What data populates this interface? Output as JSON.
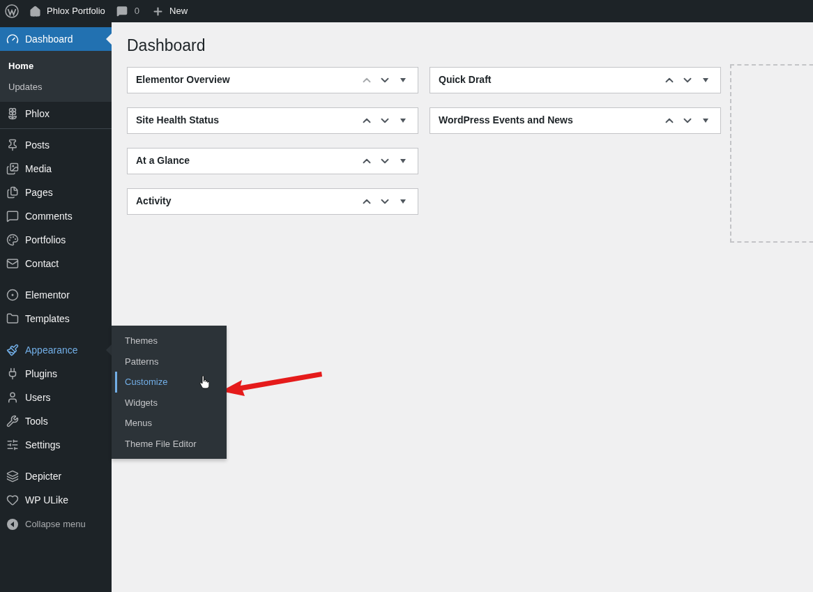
{
  "admin_bar": {
    "site_name": "Phlox Portfolio",
    "comments_count": "0",
    "new_label": "New"
  },
  "sidebar": {
    "groups": [
      [
        {
          "label": "Dashboard",
          "selected": true,
          "submenu": [
            {
              "label": "Home",
              "selected": true
            },
            {
              "label": "Updates",
              "selected": false
            }
          ]
        }
      ],
      [
        {
          "label": "Phlox",
          "selected": false,
          "highlighted": false
        }
      ],
      [
        {
          "label": "Posts",
          "selected": false,
          "highlighted": false
        },
        {
          "label": "Media",
          "selected": false,
          "highlighted": false
        },
        {
          "label": "Pages",
          "selected": false,
          "highlighted": false
        },
        {
          "label": "Comments",
          "selected": false,
          "highlighted": false
        },
        {
          "label": "Portfolios",
          "selected": false,
          "highlighted": false
        },
        {
          "label": "Contact",
          "selected": false,
          "highlighted": false
        }
      ],
      [
        {
          "label": "Elementor",
          "selected": false,
          "highlighted": false
        },
        {
          "label": "Templates",
          "selected": false,
          "highlighted": false
        }
      ],
      [
        {
          "label": "Appearance",
          "selected": false,
          "highlighted": true,
          "flyout": [
            {
              "label": "Themes",
              "selected": false
            },
            {
              "label": "Patterns",
              "selected": false
            },
            {
              "label": "Customize",
              "selected": true
            },
            {
              "label": "Widgets",
              "selected": false
            },
            {
              "label": "Menus",
              "selected": false
            },
            {
              "label": "Theme File Editor",
              "selected": false
            }
          ]
        },
        {
          "label": "Plugins",
          "selected": false,
          "highlighted": false
        },
        {
          "label": "Users",
          "selected": false,
          "highlighted": false
        },
        {
          "label": "Tools",
          "selected": false,
          "highlighted": false
        },
        {
          "label": "Settings",
          "selected": false,
          "highlighted": false
        }
      ],
      [
        {
          "label": "Depicter",
          "selected": false,
          "highlighted": false
        },
        {
          "label": "WP ULike",
          "selected": false,
          "highlighted": false
        }
      ]
    ],
    "collapse_label": "Collapse menu"
  },
  "page": {
    "title": "Dashboard",
    "columns": [
      [
        {
          "title": "Elementor Overview",
          "up_disabled": true
        },
        {
          "title": "Site Health Status",
          "up_disabled": false
        },
        {
          "title": "At a Glance",
          "up_disabled": false
        },
        {
          "title": "Activity",
          "up_disabled": false
        }
      ],
      [
        {
          "title": "Quick Draft",
          "up_disabled": false
        },
        {
          "title": "WordPress Events and News",
          "up_disabled": false
        }
      ]
    ]
  }
}
